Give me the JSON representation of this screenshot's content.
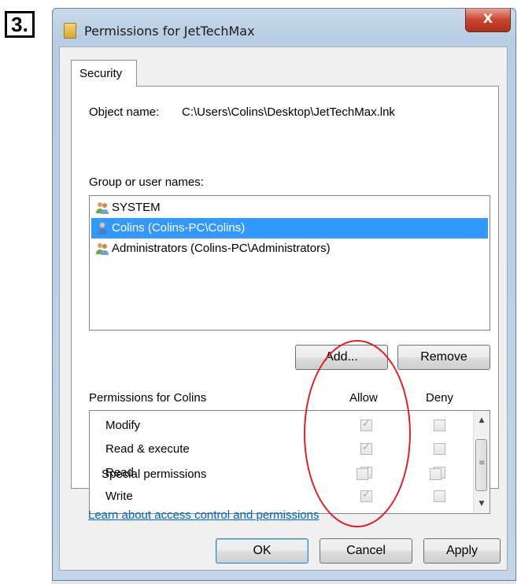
{
  "step_label": "3.",
  "window": {
    "title": "Permissions for JetTechMax",
    "close_label": "X"
  },
  "tabs": [
    {
      "label": "Security",
      "active": true
    }
  ],
  "object": {
    "label": "Object name:",
    "value": "C:\\Users\\Colins\\Desktop\\JetTechMax.lnk"
  },
  "groups": {
    "label": "Group or user names:",
    "items": [
      {
        "name": "SYSTEM",
        "icon": "users-group-icon",
        "selected": false
      },
      {
        "name": "Colins (Colins-PC\\Colins)",
        "icon": "user-icon",
        "selected": true
      },
      {
        "name": "Administrators (Colins-PC\\Administrators)",
        "icon": "users-group-icon",
        "selected": false
      }
    ],
    "add_label": "Add...",
    "remove_label": "Remove"
  },
  "permissions": {
    "header": "Permissions for Colins",
    "allow_label": "Allow",
    "deny_label": "Deny",
    "rows": [
      {
        "name": "Modify",
        "allow": true,
        "deny": false
      },
      {
        "name": "Read & execute",
        "allow": true,
        "deny": false
      },
      {
        "name": "Read",
        "allow": true,
        "deny": false
      },
      {
        "name": "Write",
        "allow": true,
        "deny": false
      },
      {
        "name": "Special permissions",
        "allow": false,
        "deny": false
      }
    ]
  },
  "link_text": "Learn about access control and permissions",
  "buttons": {
    "ok": "OK",
    "cancel": "Cancel",
    "apply": "Apply"
  },
  "colors": {
    "selection": "#3399ff",
    "annotation": "#e02020",
    "link": "#0066cc"
  }
}
